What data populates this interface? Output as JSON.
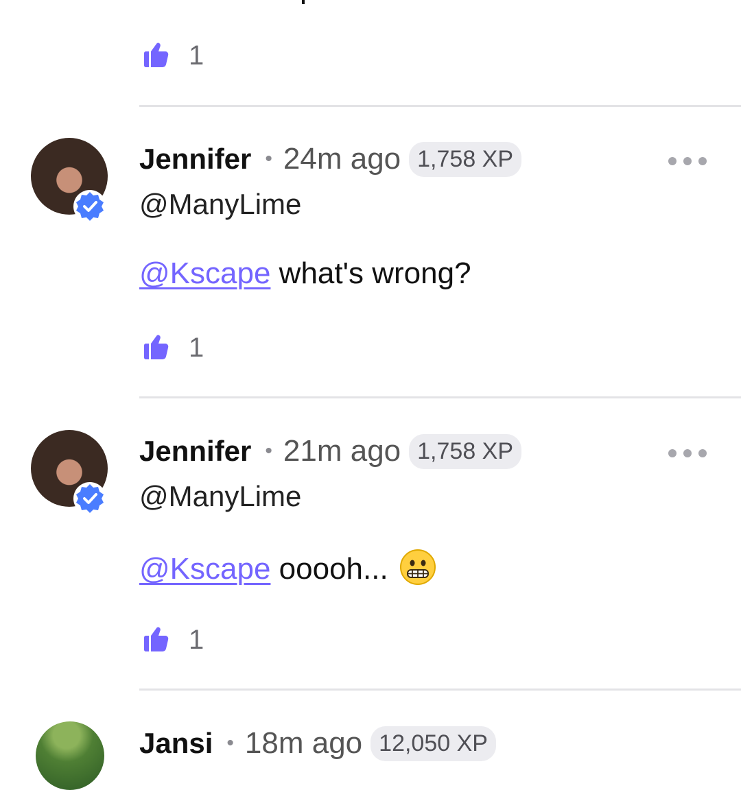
{
  "app": {
    "accent": "#7465ff",
    "verified_color": "#4a7dff"
  },
  "comments": [
    {
      "like_count": "1"
    },
    {
      "author": "Jennifer",
      "time": "24m ago",
      "xp": "1,758 XP",
      "handle": "@ManyLime",
      "mention": "@Kscape",
      "text": "what's wrong?",
      "like_count": "1"
    },
    {
      "author": "Jennifer",
      "time": "21m ago",
      "xp": "1,758 XP",
      "handle": "@ManyLime",
      "mention": "@Kscape",
      "text": "ooooh...",
      "emoji": "grimacing-face",
      "like_count": "1"
    },
    {
      "author": "Jansi",
      "time": "18m ago",
      "xp": "12,050 XP"
    }
  ],
  "icons": {
    "like": "thumbs-up-icon",
    "more": "more-options-icon",
    "verified": "verified-badge-icon"
  }
}
